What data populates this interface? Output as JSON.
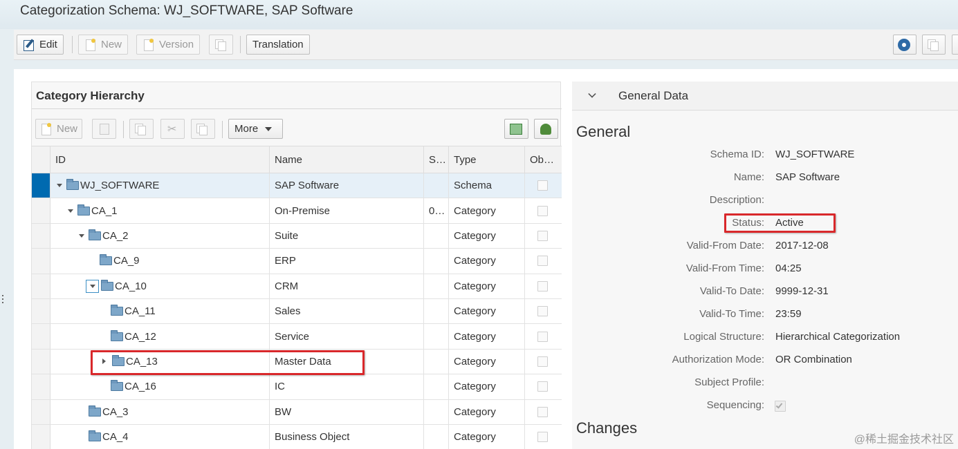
{
  "window": {
    "title": "Categorization Schema: WJ_SOFTWARE, SAP Software"
  },
  "toolbar": {
    "edit_label": "Edit",
    "new_label": "New",
    "version_label": "Version",
    "translation_label": "Translation"
  },
  "hierarchy": {
    "title": "Category Hierarchy",
    "toolbar": {
      "new_label": "New",
      "more_label": "More"
    },
    "columns": [
      "ID",
      "Name",
      "S…",
      "Type",
      "Ob…"
    ],
    "rows": [
      {
        "id": "WJ_SOFTWARE",
        "name": "SAP Software",
        "s": "",
        "type": "Schema",
        "level": 0,
        "expander": "down",
        "selected": true
      },
      {
        "id": "CA_1",
        "name": "On-Premise",
        "s": "0…",
        "type": "Category",
        "level": 1,
        "expander": "down",
        "selected": false
      },
      {
        "id": "CA_2",
        "name": "Suite",
        "s": "",
        "type": "Category",
        "level": 2,
        "expander": "down",
        "selected": false
      },
      {
        "id": "CA_9",
        "name": "ERP",
        "s": "",
        "type": "Category",
        "level": 3,
        "expander": "none",
        "selected": false
      },
      {
        "id": "CA_10",
        "name": "CRM",
        "s": "",
        "type": "Category",
        "level": 3,
        "expander": "down-focused",
        "selected": false
      },
      {
        "id": "CA_11",
        "name": "Sales",
        "s": "",
        "type": "Category",
        "level": 4,
        "expander": "none",
        "selected": false
      },
      {
        "id": "CA_12",
        "name": "Service",
        "s": "",
        "type": "Category",
        "level": 4,
        "expander": "none",
        "selected": false
      },
      {
        "id": "CA_13",
        "name": "Master Data",
        "s": "",
        "type": "Category",
        "level": 4,
        "expander": "right",
        "selected": false
      },
      {
        "id": "CA_16",
        "name": "IC",
        "s": "",
        "type": "Category",
        "level": 4,
        "expander": "none",
        "selected": false
      },
      {
        "id": "CA_3",
        "name": "BW",
        "s": "",
        "type": "Category",
        "level": 2,
        "expander": "none",
        "selected": false
      },
      {
        "id": "CA_4",
        "name": "Business Object",
        "s": "",
        "type": "Category",
        "level": 2,
        "expander": "none",
        "selected": false
      }
    ]
  },
  "general_data": {
    "header": "General Data",
    "section_general": "General",
    "fields": [
      {
        "label": "Schema ID:",
        "value": "WJ_SOFTWARE"
      },
      {
        "label": "Name:",
        "value": "SAP Software"
      },
      {
        "label": "Description:",
        "value": ""
      },
      {
        "label": "Status:",
        "value": "Active"
      },
      {
        "label": "Valid-From Date:",
        "value": "2017-12-08"
      },
      {
        "label": "Valid-From Time:",
        "value": "04:25"
      },
      {
        "label": "Valid-To Date:",
        "value": "9999-12-31"
      },
      {
        "label": "Valid-To Time:",
        "value": "23:59"
      },
      {
        "label": "Logical Structure:",
        "value": "Hierarchical Categorization"
      },
      {
        "label": "Authorization Mode:",
        "value": "OR Combination"
      },
      {
        "label": "Subject Profile:",
        "value": ""
      },
      {
        "label": "Sequencing:",
        "value": ""
      }
    ],
    "sequencing_checked": true,
    "section_changes": "Changes"
  },
  "watermark": "@稀土掘金技术社区",
  "colors": {
    "selection": "#006ab0",
    "highlight_box": "#d9282b",
    "folder": "#7ea7c9"
  }
}
